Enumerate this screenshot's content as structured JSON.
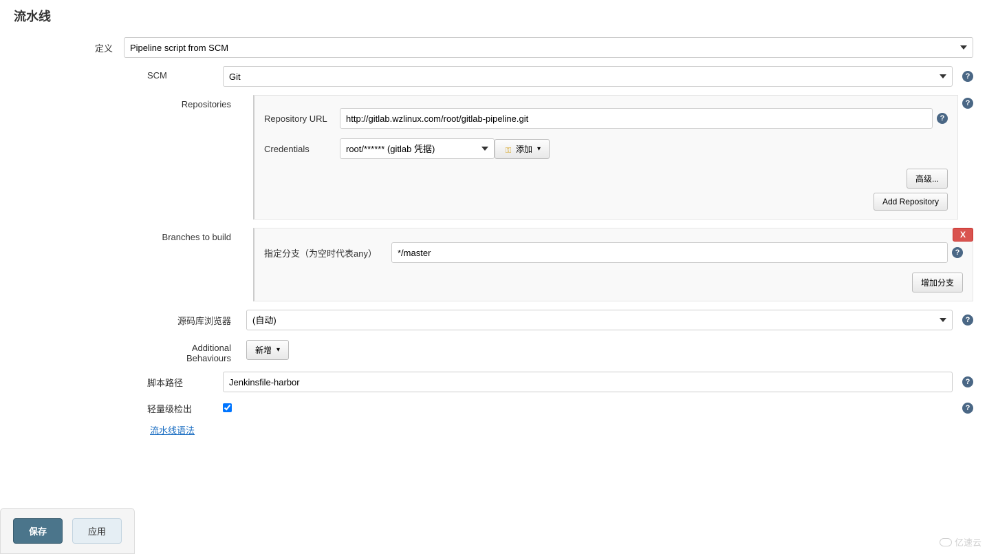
{
  "section_title": "流水线",
  "definition": {
    "label": "定义",
    "value": "Pipeline script from SCM"
  },
  "scm": {
    "label": "SCM",
    "value": "Git"
  },
  "repositories": {
    "label": "Repositories",
    "url_label": "Repository URL",
    "url_value": "http://gitlab.wzlinux.com/root/gitlab-pipeline.git",
    "credentials_label": "Credentials",
    "credentials_value": "root/****** (gitlab 凭据)",
    "add_button": "添加",
    "advanced_button": "高级...",
    "add_repo_button": "Add Repository"
  },
  "branches": {
    "label": "Branches to build",
    "spec_label": "指定分支（为空时代表any）",
    "spec_value": "*/master",
    "delete_label": "X",
    "add_branch_button": "增加分支"
  },
  "repo_browser": {
    "label": "源码库浏览器",
    "value": "(自动)"
  },
  "additional_behaviours": {
    "label": "Additional Behaviours",
    "add_button": "新增"
  },
  "script_path": {
    "label": "脚本路径",
    "value": "Jenkinsfile-harbor"
  },
  "lightweight": {
    "label": "轻量级检出"
  },
  "syntax_link": "流水线语法",
  "buttons": {
    "save": "保存",
    "apply": "应用"
  },
  "watermark": "亿速云"
}
